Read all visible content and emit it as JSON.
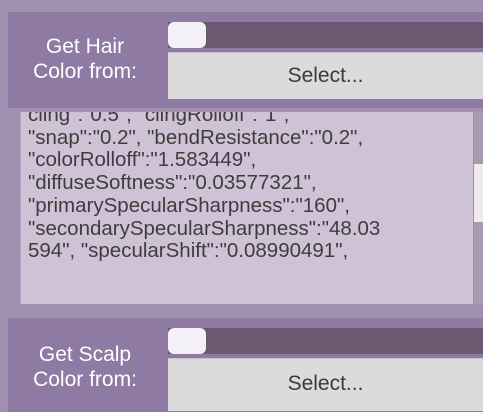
{
  "hair_color": {
    "label": "Get Hair\nColor from:",
    "button_label": "Select...",
    "slider_value": 0
  },
  "json_text": {
    "lines": [
      "cling\":\"0.5\", \"clingRolloff\":\"1\",",
      "\"snap\":\"0.2\", \"bendResistance\":\"0.2\",",
      "\"colorRolloff\":\"1.583449\",",
      "\"diffuseSoftness\":\"0.03577321\",",
      "\"primarySpecularSharpness\":\"160\",",
      "\"secondarySpecularSharpness\":\"48.03",
      "594\", \"specularShift\":\"0.08990491\","
    ]
  },
  "scalp_color": {
    "label": "Get Scalp\nColor from:",
    "button_label": "Select...",
    "slider_value": 0
  }
}
